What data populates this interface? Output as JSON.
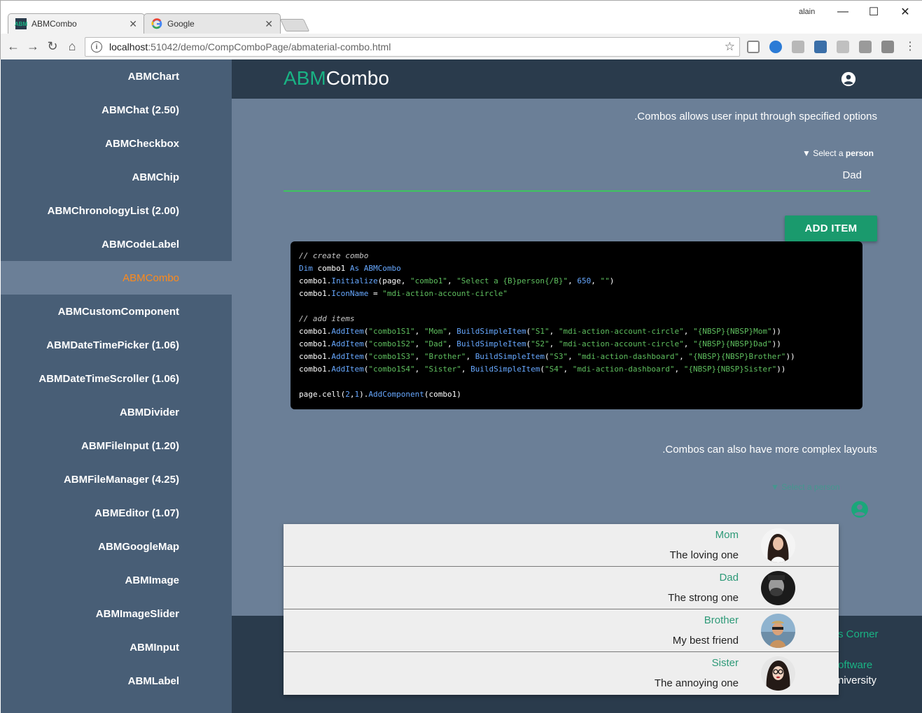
{
  "browser": {
    "tabs": [
      {
        "label": "ABMCombo",
        "favicon": "abm-favicon"
      },
      {
        "label": "Google",
        "favicon": "google-favicon"
      }
    ],
    "user": "alain",
    "url_host": "localhost",
    "url_path": ":51042/demo/CompComboPage/abmaterial-combo.html"
  },
  "sidebar": {
    "items": [
      {
        "label": "ABMChart"
      },
      {
        "label": "ABMChat (2.50)"
      },
      {
        "label": "ABMCheckbox"
      },
      {
        "label": "ABMChip"
      },
      {
        "label": "ABMChronologyList (2.00)"
      },
      {
        "label": "ABMCodeLabel"
      },
      {
        "label": "ABMCombo"
      },
      {
        "label": "ABMCustomComponent"
      },
      {
        "label": "ABMDateTimePicker (1.06)"
      },
      {
        "label": "ABMDateTimeScroller (1.06)"
      },
      {
        "label": "ABMDivider"
      },
      {
        "label": "ABMFileInput (1.20)"
      },
      {
        "label": "ABMFileManager (4.25)"
      },
      {
        "label": "ABMEditor (1.07)"
      },
      {
        "label": "ABMGoogleMap"
      },
      {
        "label": "ABMImage"
      },
      {
        "label": "ABMImageSlider"
      },
      {
        "label": "ABMInput"
      },
      {
        "label": "ABMLabel"
      }
    ],
    "active_index": 6
  },
  "header": {
    "title_accent": "ABM",
    "title_rest": "Combo"
  },
  "main": {
    "intro1": ".Combos allows user input through specified options",
    "combo1": {
      "label_prefix": "▼ Select a ",
      "label_bold": "person",
      "value": "Dad"
    },
    "add_item_label": "ADD ITEM",
    "intro2": ".Combos can also have more complex layouts",
    "combo2": {
      "label": "▼ Select a person"
    },
    "code": {
      "comment1": "// create combo",
      "l2_kw1": "Dim",
      "l2_mid": " combo1 ",
      "l2_kw2": "As",
      "l2_type": " ABMCombo",
      "l3_a": "combo1.",
      "l3_fn": "Initialize",
      "l3_b": "(page, ",
      "l3_s1": "\"combo1\"",
      "l3_c": ", ",
      "l3_s2": "\"Select a {B}person{/B}\"",
      "l3_d": ", ",
      "l3_n": "650",
      "l3_e": ", ",
      "l3_s3": "\"\"",
      "l3_f": ")",
      "l4_a": "combo1.",
      "l4_fn": "IconName",
      "l4_b": " = ",
      "l4_s": "\"mdi-action-account-circle\"",
      "comment2": "// add items",
      "add_items": [
        {
          "id": "\"combo1S1\"",
          "name": "\"Mom\"",
          "sid": "\"S1\"",
          "icon": "\"mdi-action-account-circle\"",
          "text": "\"{NBSP}{NBSP}Mom\""
        },
        {
          "id": "\"combo1S2\"",
          "name": "\"Dad\"",
          "sid": "\"S2\"",
          "icon": "\"mdi-action-account-circle\"",
          "text": "\"{NBSP}{NBSP}Dad\""
        },
        {
          "id": "\"combo1S3\"",
          "name": "\"Brother\"",
          "sid": "\"S3\"",
          "icon": "\"mdi-action-dashboard\"",
          "text": "\"{NBSP}{NBSP}Brother\""
        },
        {
          "id": "\"combo1S4\"",
          "name": "\"Sister\"",
          "sid": "\"S4\"",
          "icon": "\"mdi-action-dashboard\"",
          "text": "\"{NBSP}{NBSP}Sister\""
        }
      ],
      "fn_additem": "AddItem",
      "fn_build": "BuildSimpleItem",
      "obj": "combo1.",
      "l_last_a": "page.cell(",
      "l_last_n1": "2",
      "l_last_b": ",",
      "l_last_n2": "1",
      "l_last_c": ").",
      "l_last_fn": "AddComponent",
      "l_last_d": "(combo1)"
    }
  },
  "dropdown": {
    "items": [
      {
        "name": "Mom",
        "desc": "The loving one"
      },
      {
        "name": "Dad",
        "desc": "The strong one"
      },
      {
        "name": "Brother",
        "desc": "My best friend"
      },
      {
        "name": "Sister",
        "desc": "The annoying one"
      }
    ]
  },
  "footer": {
    "link1": "s Corner",
    "link2": "oftware",
    "link3": "niversity"
  },
  "colors": {
    "sidebar_bg": "#485e76",
    "main_bg": "#6b7f97",
    "header_bg": "#2a3b4c",
    "accent_green": "#19b384",
    "active_orange": "#ff8a1a"
  }
}
